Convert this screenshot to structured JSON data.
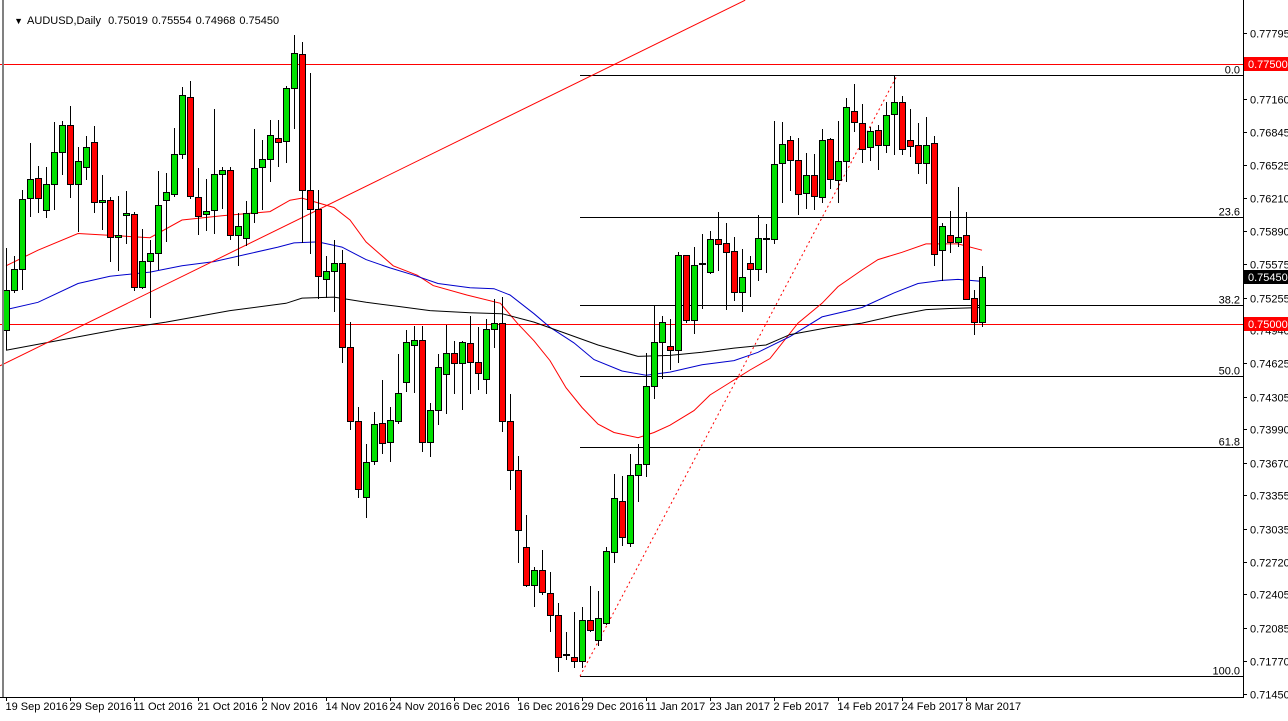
{
  "header": {
    "menu_icon": "triangle-down-icon",
    "symbol": "AUDUSD,Daily",
    "open": "0.75019",
    "high": "0.75554",
    "low": "0.74968",
    "close": "0.75450"
  },
  "colors": {
    "bull": "#00e000",
    "bear": "#ff0000",
    "ma_fast": "#ff0000",
    "ma_mid": "#0000cc",
    "ma_slow": "#000000",
    "hline": "#ff0000",
    "fib": "#000000",
    "trend": "#ff0000"
  },
  "chart_data": {
    "type": "candlestick",
    "title": "AUDUSD,Daily",
    "ylim": [
      0.7145,
      0.77795
    ],
    "grid": false,
    "y_ticks": [
      "0.77795",
      "0.77160",
      "0.76845",
      "0.76525",
      "0.76210",
      "0.75890",
      "0.75575",
      "0.75255",
      "0.74940",
      "0.74625",
      "0.74305",
      "0.73990",
      "0.73670",
      "0.73355",
      "0.73035",
      "0.72720",
      "0.72405",
      "0.72085",
      "0.71770",
      "0.71450"
    ],
    "x_labels": [
      {
        "index": 0,
        "label": "19 Sep 2016"
      },
      {
        "index": 8,
        "label": "29 Sep 2016"
      },
      {
        "index": 16,
        "label": "11 Oct 2016"
      },
      {
        "index": 24,
        "label": "21 Oct 2016"
      },
      {
        "index": 32,
        "label": "2 Nov 2016"
      },
      {
        "index": 40,
        "label": "14 Nov 2016"
      },
      {
        "index": 48,
        "label": "24 Nov 2016"
      },
      {
        "index": 56,
        "label": "6 Dec 2016"
      },
      {
        "index": 64,
        "label": "16 Dec 2016"
      },
      {
        "index": 72,
        "label": "29 Dec 2016"
      },
      {
        "index": 80,
        "label": "11 Jan 2017"
      },
      {
        "index": 88,
        "label": "23 Jan 2017"
      },
      {
        "index": 96,
        "label": "2 Feb 2017"
      },
      {
        "index": 104,
        "label": "14 Feb 2017"
      },
      {
        "index": 112,
        "label": "24 Feb 2017"
      },
      {
        "index": 120,
        "label": "8 Mar 2017"
      }
    ],
    "candles_ohlc": [
      [
        0.7494,
        0.7573,
        0.7475,
        0.7533
      ],
      [
        0.7533,
        0.7565,
        0.753,
        0.7553
      ],
      [
        0.7553,
        0.7629,
        0.7533,
        0.762
      ],
      [
        0.7621,
        0.7674,
        0.7603,
        0.7639
      ],
      [
        0.764,
        0.7652,
        0.7607,
        0.7621
      ],
      [
        0.761,
        0.7651,
        0.7602,
        0.7635
      ],
      [
        0.7635,
        0.7694,
        0.761,
        0.7665
      ],
      [
        0.7665,
        0.7695,
        0.7643,
        0.7691
      ],
      [
        0.7691,
        0.7709,
        0.7621,
        0.7635
      ],
      [
        0.7635,
        0.767,
        0.7588,
        0.7657
      ],
      [
        0.7651,
        0.7681,
        0.7638,
        0.767
      ],
      [
        0.7675,
        0.769,
        0.7607,
        0.7617
      ],
      [
        0.7617,
        0.7643,
        0.759,
        0.7619
      ],
      [
        0.7619,
        0.7622,
        0.756,
        0.7584
      ],
      [
        0.7584,
        0.7623,
        0.7551,
        0.7586
      ],
      [
        0.7605,
        0.7628,
        0.7577,
        0.7607
      ],
      [
        0.7606,
        0.7608,
        0.7532,
        0.7536
      ],
      [
        0.7536,
        0.7591,
        0.7534,
        0.7561
      ],
      [
        0.7561,
        0.7581,
        0.7506,
        0.7568
      ],
      [
        0.7568,
        0.7647,
        0.7552,
        0.7614
      ],
      [
        0.7619,
        0.7645,
        0.7579,
        0.7627
      ],
      [
        0.7625,
        0.7688,
        0.7622,
        0.7663
      ],
      [
        0.7663,
        0.7728,
        0.7659,
        0.772
      ],
      [
        0.7718,
        0.7733,
        0.762,
        0.7623
      ],
      [
        0.7622,
        0.765,
        0.7586,
        0.7604
      ],
      [
        0.7606,
        0.7639,
        0.7589,
        0.7609
      ],
      [
        0.761,
        0.7707,
        0.7587,
        0.7644
      ],
      [
        0.7644,
        0.7651,
        0.7611,
        0.7648
      ],
      [
        0.7648,
        0.7651,
        0.7581,
        0.7586
      ],
      [
        0.7586,
        0.7607,
        0.7556,
        0.7594
      ],
      [
        0.7583,
        0.7618,
        0.7575,
        0.7607
      ],
      [
        0.7607,
        0.7687,
        0.7597,
        0.765
      ],
      [
        0.7651,
        0.7677,
        0.761,
        0.7659
      ],
      [
        0.7659,
        0.7696,
        0.7636,
        0.7682
      ],
      [
        0.7679,
        0.7696,
        0.7651,
        0.7675
      ],
      [
        0.7676,
        0.7729,
        0.7655,
        0.7727
      ],
      [
        0.7727,
        0.7778,
        0.7687,
        0.776
      ],
      [
        0.7759,
        0.7771,
        0.7578,
        0.7629
      ],
      [
        0.7629,
        0.7741,
        0.7567,
        0.7611
      ],
      [
        0.7611,
        0.7629,
        0.7524,
        0.7546
      ],
      [
        0.7543,
        0.7565,
        0.7525,
        0.7551
      ],
      [
        0.7551,
        0.7581,
        0.7512,
        0.7559
      ],
      [
        0.7559,
        0.7571,
        0.7463,
        0.7478
      ],
      [
        0.7478,
        0.7502,
        0.7398,
        0.7407
      ],
      [
        0.7407,
        0.742,
        0.7333,
        0.7342
      ],
      [
        0.7334,
        0.7385,
        0.7314,
        0.7368
      ],
      [
        0.7369,
        0.7416,
        0.7365,
        0.7404
      ],
      [
        0.7405,
        0.7446,
        0.7375,
        0.7386
      ],
      [
        0.7387,
        0.742,
        0.7368,
        0.7408
      ],
      [
        0.7407,
        0.7471,
        0.7404,
        0.7434
      ],
      [
        0.7444,
        0.7494,
        0.7435,
        0.7483
      ],
      [
        0.748,
        0.7498,
        0.7434,
        0.7485
      ],
      [
        0.7485,
        0.7498,
        0.7377,
        0.7387
      ],
      [
        0.7387,
        0.7424,
        0.7372,
        0.7418
      ],
      [
        0.7418,
        0.7471,
        0.7403,
        0.7459
      ],
      [
        0.7452,
        0.7499,
        0.7414,
        0.7472
      ],
      [
        0.7472,
        0.7484,
        0.7433,
        0.7463
      ],
      [
        0.7463,
        0.7484,
        0.7418,
        0.7483
      ],
      [
        0.7482,
        0.7508,
        0.7433,
        0.7464
      ],
      [
        0.7464,
        0.7497,
        0.7437,
        0.7453
      ],
      [
        0.7447,
        0.7505,
        0.7433,
        0.7495
      ],
      [
        0.7495,
        0.7524,
        0.7477,
        0.7501
      ],
      [
        0.7501,
        0.7526,
        0.7396,
        0.7407
      ],
      [
        0.7407,
        0.7433,
        0.7341,
        0.736
      ],
      [
        0.736,
        0.7373,
        0.7271,
        0.7302
      ],
      [
        0.7286,
        0.7317,
        0.7248,
        0.725
      ],
      [
        0.725,
        0.7267,
        0.7228,
        0.7264
      ],
      [
        0.7264,
        0.7283,
        0.724,
        0.7243
      ],
      [
        0.7242,
        0.7262,
        0.7204,
        0.7221
      ],
      [
        0.7221,
        0.7232,
        0.7166,
        0.718
      ],
      [
        0.7182,
        0.7204,
        0.7178,
        0.7183
      ],
      [
        0.718,
        0.7224,
        0.717,
        0.7177
      ],
      [
        0.7177,
        0.7228,
        0.717,
        0.7216
      ],
      [
        0.7216,
        0.7249,
        0.7204,
        0.7206
      ],
      [
        0.7197,
        0.7244,
        0.7191,
        0.7218
      ],
      [
        0.7213,
        0.7286,
        0.7211,
        0.7282
      ],
      [
        0.7281,
        0.7356,
        0.7271,
        0.7333
      ],
      [
        0.733,
        0.7354,
        0.7287,
        0.7296
      ],
      [
        0.729,
        0.7375,
        0.7286,
        0.7355
      ],
      [
        0.7355,
        0.7385,
        0.7329,
        0.7366
      ],
      [
        0.7366,
        0.7472,
        0.7353,
        0.7441
      ],
      [
        0.7441,
        0.7518,
        0.7428,
        0.7483
      ],
      [
        0.7483,
        0.7508,
        0.7447,
        0.7502
      ],
      [
        0.7479,
        0.7505,
        0.7456,
        0.7475
      ],
      [
        0.7475,
        0.7569,
        0.7463,
        0.7566
      ],
      [
        0.7566,
        0.7566,
        0.7501,
        0.7504
      ],
      [
        0.7504,
        0.7574,
        0.7491,
        0.7557
      ],
      [
        0.7558,
        0.7587,
        0.7515,
        0.7559
      ],
      [
        0.755,
        0.7589,
        0.7548,
        0.7582
      ],
      [
        0.7582,
        0.7608,
        0.7551,
        0.7577
      ],
      [
        0.7578,
        0.7597,
        0.7514,
        0.7569
      ],
      [
        0.757,
        0.7584,
        0.7522,
        0.7531
      ],
      [
        0.7531,
        0.7572,
        0.7512,
        0.7545
      ],
      [
        0.7559,
        0.7565,
        0.7526,
        0.7553
      ],
      [
        0.7553,
        0.7605,
        0.7541,
        0.7583
      ],
      [
        0.7582,
        0.7596,
        0.7549,
        0.7583
      ],
      [
        0.7582,
        0.7695,
        0.7577,
        0.7654
      ],
      [
        0.7655,
        0.7694,
        0.7616,
        0.7673
      ],
      [
        0.7677,
        0.7681,
        0.7628,
        0.7658
      ],
      [
        0.7658,
        0.7679,
        0.7605,
        0.7625
      ],
      [
        0.7626,
        0.7664,
        0.7611,
        0.7643
      ],
      [
        0.7643,
        0.7663,
        0.761,
        0.7623
      ],
      [
        0.7622,
        0.7687,
        0.7616,
        0.7677
      ],
      [
        0.7678,
        0.7679,
        0.763,
        0.7639
      ],
      [
        0.7638,
        0.7695,
        0.7616,
        0.7657
      ],
      [
        0.7657,
        0.7717,
        0.7636,
        0.7708
      ],
      [
        0.7705,
        0.7731,
        0.7684,
        0.7694
      ],
      [
        0.7693,
        0.7711,
        0.7655,
        0.7668
      ],
      [
        0.767,
        0.7689,
        0.7657,
        0.7685
      ],
      [
        0.7686,
        0.7691,
        0.7648,
        0.7672
      ],
      [
        0.7672,
        0.7713,
        0.7664,
        0.7701
      ],
      [
        0.7702,
        0.7739,
        0.7662,
        0.7713
      ],
      [
        0.7713,
        0.7719,
        0.7662,
        0.7668
      ],
      [
        0.7677,
        0.7707,
        0.766,
        0.7671
      ],
      [
        0.7672,
        0.7693,
        0.7644,
        0.7655
      ],
      [
        0.7655,
        0.7699,
        0.7635,
        0.7672
      ],
      [
        0.7674,
        0.7681,
        0.7556,
        0.7567
      ],
      [
        0.7571,
        0.7597,
        0.7541,
        0.7594
      ],
      [
        0.7586,
        0.7609,
        0.7568,
        0.7579
      ],
      [
        0.7579,
        0.7632,
        0.7574,
        0.7584
      ],
      [
        0.7586,
        0.7608,
        0.7524,
        0.7524
      ],
      [
        0.7525,
        0.7533,
        0.749,
        0.7502
      ],
      [
        0.75019,
        0.75554,
        0.74968,
        0.7545
      ]
    ],
    "moving_averages": [
      {
        "name": "ma_fast",
        "color_key": "ma_fast",
        "points": [
          [
            0,
            0.7556
          ],
          [
            4,
            0.7571
          ],
          [
            9,
            0.7587
          ],
          [
            18,
            0.7583
          ],
          [
            22,
            0.76
          ],
          [
            27,
            0.7604
          ],
          [
            33,
            0.7608
          ],
          [
            35.5,
            0.7619
          ],
          [
            37,
            0.7621
          ],
          [
            41,
            0.7612
          ],
          [
            43,
            0.76
          ],
          [
            45,
            0.7579
          ],
          [
            48.4,
            0.7556
          ],
          [
            51.4,
            0.7547
          ],
          [
            53.4,
            0.7537
          ],
          [
            57.6,
            0.7528
          ],
          [
            61.8,
            0.752
          ],
          [
            63.9,
            0.7501
          ],
          [
            66,
            0.7484
          ],
          [
            68,
            0.7465
          ],
          [
            70,
            0.7439
          ],
          [
            72,
            0.742
          ],
          [
            74,
            0.7404
          ],
          [
            76,
            0.7396
          ],
          [
            79,
            0.7391
          ],
          [
            81,
            0.7396
          ],
          [
            83,
            0.7403
          ],
          [
            86,
            0.7417
          ],
          [
            88,
            0.7432
          ],
          [
            90.5,
            0.7444
          ],
          [
            93,
            0.7456
          ],
          [
            95.5,
            0.7467
          ],
          [
            99,
            0.7501
          ],
          [
            102,
            0.752
          ],
          [
            104,
            0.7536
          ],
          [
            107,
            0.7552
          ],
          [
            109,
            0.7562
          ],
          [
            112,
            0.7569
          ],
          [
            115,
            0.7577
          ],
          [
            119,
            0.7577
          ],
          [
            122,
            0.7571
          ]
        ]
      },
      {
        "name": "ma_mid",
        "color_key": "ma_mid",
        "points": [
          [
            0,
            0.7514
          ],
          [
            4,
            0.7521
          ],
          [
            9,
            0.7539
          ],
          [
            13,
            0.7546
          ],
          [
            18,
            0.755
          ],
          [
            22,
            0.7556
          ],
          [
            26,
            0.756
          ],
          [
            30,
            0.7567
          ],
          [
            34,
            0.7574
          ],
          [
            36,
            0.7578
          ],
          [
            39,
            0.7579
          ],
          [
            42,
            0.7574
          ],
          [
            45,
            0.7562
          ],
          [
            48,
            0.7554
          ],
          [
            51,
            0.7547
          ],
          [
            54,
            0.7539
          ],
          [
            58,
            0.7535
          ],
          [
            61,
            0.7534
          ],
          [
            63,
            0.7528
          ],
          [
            66,
            0.751
          ],
          [
            68,
            0.7497
          ],
          [
            70,
            0.7487
          ],
          [
            71,
            0.7482
          ],
          [
            73.5,
            0.7466
          ],
          [
            77,
            0.7455
          ],
          [
            80,
            0.7451
          ],
          [
            83,
            0.7454
          ],
          [
            87,
            0.7461
          ],
          [
            91,
            0.7465
          ],
          [
            94,
            0.7473
          ],
          [
            98,
            0.7488
          ],
          [
            102,
            0.7507
          ],
          [
            107,
            0.7516
          ],
          [
            111,
            0.753
          ],
          [
            114,
            0.7539
          ],
          [
            117,
            0.7542
          ],
          [
            119,
            0.7543
          ],
          [
            122,
            0.7541
          ]
        ]
      },
      {
        "name": "ma_slow",
        "color_key": "ma_slow",
        "points": [
          [
            0,
            0.7475
          ],
          [
            14,
            0.7495
          ],
          [
            20,
            0.7502
          ],
          [
            28,
            0.7513
          ],
          [
            35,
            0.752
          ],
          [
            37,
            0.7525
          ],
          [
            41,
            0.7526
          ],
          [
            45,
            0.7521
          ],
          [
            49,
            0.7517
          ],
          [
            53,
            0.7513
          ],
          [
            58,
            0.7511
          ],
          [
            62,
            0.751
          ],
          [
            66,
            0.7502
          ],
          [
            70,
            0.7491
          ],
          [
            74,
            0.748
          ],
          [
            79,
            0.7469
          ],
          [
            83,
            0.747
          ],
          [
            87,
            0.7473
          ],
          [
            91,
            0.7477
          ],
          [
            95,
            0.748
          ],
          [
            98,
            0.749
          ],
          [
            103,
            0.7497
          ],
          [
            107,
            0.7501
          ],
          [
            111,
            0.7508
          ],
          [
            115,
            0.7514
          ],
          [
            118,
            0.7515
          ],
          [
            122,
            0.7516
          ]
        ]
      }
    ],
    "horizontal_lines": [
      {
        "price": 0.775,
        "label": "0.77500"
      },
      {
        "price": 0.75,
        "label": "0.75000"
      }
    ],
    "current_price": {
      "price": 0.7545,
      "label": "0.75450"
    },
    "fibonacci": {
      "high": 0.7739,
      "low": 0.7162,
      "start_index": 71.75,
      "levels": [
        {
          "ratio": 0,
          "label": "0.0"
        },
        {
          "ratio": 0.236,
          "label": "23.6"
        },
        {
          "ratio": 0.382,
          "label": "38.2"
        },
        {
          "ratio": 0.5,
          "label": "50.0"
        },
        {
          "ratio": 0.618,
          "label": "61.8"
        },
        {
          "ratio": 1,
          "label": "100.0"
        }
      ]
    },
    "trendlines": [
      {
        "name": "rising-trendline",
        "style": "solid",
        "from": [
          -0.75,
          0.746
        ],
        "to": [
          92.4,
          0.7811
        ]
      },
      {
        "name": "fib-swing-line",
        "style": "dotted",
        "from": [
          71.75,
          0.7162
        ],
        "to": [
          111.4,
          0.7739
        ]
      }
    ]
  }
}
